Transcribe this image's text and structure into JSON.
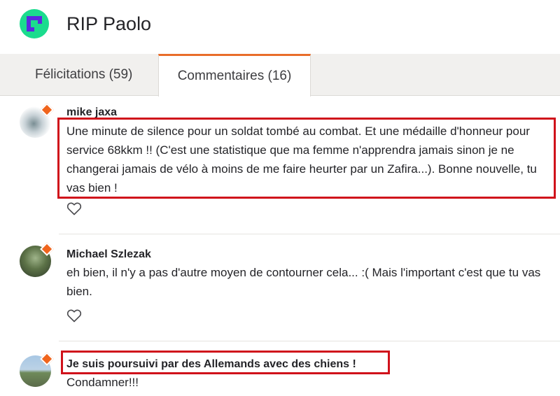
{
  "header": {
    "title": "RIP Paolo",
    "logo_color": "#1bdc8e",
    "logo_mark_color": "#5a2be0"
  },
  "tabs": [
    {
      "label": "Félicitations (59)",
      "active": false
    },
    {
      "label": "Commentaires (16)",
      "active": true
    }
  ],
  "comments": [
    {
      "author": "mike jaxa",
      "text": "Une minute de silence pour un soldat tombé au combat. Et une médaille d'honneur pour service 68kkm !! (C'est une statistique que ma femme n'apprendra jamais sinon je ne changerai jamais de vélo à moins de me faire heurter par un Zafira...). Bonne nouvelle, tu vas bien !",
      "icon": "heart-outline-icon"
    },
    {
      "author": "Michael Szlezak",
      "text": "eh bien, il n'y a pas d'autre moyen de contourner cela... :( Mais l'important c'est que tu vas bien.",
      "icon": "heart-outline-icon"
    },
    {
      "author": "Je suis poursuivi par des Allemands avec des chiens !",
      "text": "Condamner!!!"
    }
  ],
  "colors": {
    "accent_tab": "#e96d2a",
    "highlight": "#d0121b",
    "badge": "#f0641c"
  }
}
